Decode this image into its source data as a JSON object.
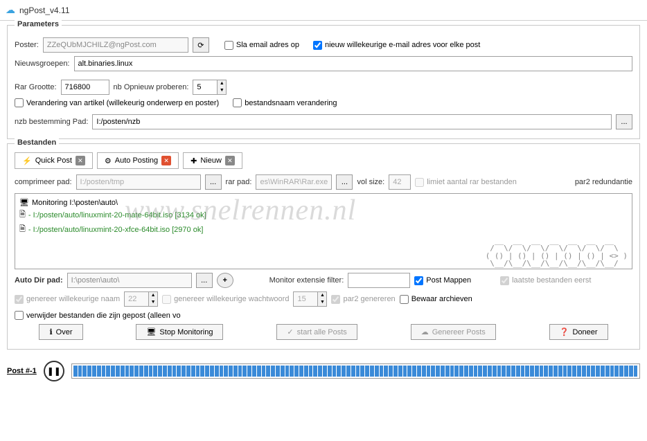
{
  "app": {
    "title": "ngPost_v4.11"
  },
  "params": {
    "legend": "Parameters",
    "poster_label": "Poster:",
    "poster_value": "ZZeQUbMJCHILZ@ngPost.com",
    "save_email_label": "Sla email adres op",
    "random_email_label": "nieuw willekeurige e-mail adres voor elke post",
    "newsgroups_label": "Nieuwsgroepen:",
    "newsgroups_value": "alt.binaries.linux",
    "rar_size_label": "Rar Grootte:",
    "rar_size_value": "716800",
    "retry_label": "nb Opnieuw proberen:",
    "retry_value": "5",
    "obfuscate_label": "Verandering van artikel (willekeurig onderwerp en poster)",
    "filename_obf_label": "bestandsnaam verandering",
    "nzb_path_label": "nzb bestemming Pad:",
    "nzb_path_value": "I:/posten/nzb"
  },
  "files": {
    "legend": "Bestanden",
    "tabs": {
      "quick": "Quick Post",
      "auto": "Auto Posting",
      "new": "Nieuw"
    },
    "compress_label": "comprimeer pad:",
    "compress_value": "I:/posten/tmp",
    "rar_path_label": "rar pad:",
    "rar_path_value": "es\\WinRAR\\Rar.exe",
    "vol_size_label": "vol size:",
    "vol_size_value": "42",
    "limit_rar_label": "limiet aantal rar bestanden",
    "par2_label": "par2 redundantie",
    "log": {
      "line1": "Monitoring I:\\posten\\auto\\",
      "line2": "- I:/posten/auto/linuxmint-20-mate-64bit.iso [3134 ok]",
      "line3": "- I:/posten/auto/linuxmint-20-xfce-64bit.iso [2970 ok]"
    },
    "autodir_label": "Auto Dir pad:",
    "autodir_value": "I:\\posten\\auto\\",
    "monitor_ext_label": "Monitor extensie filter:",
    "post_folders_label": "Post Mappen",
    "latest_first_label": "laatste bestanden eerst",
    "gen_name_label": "genereer willekeurige naam",
    "gen_name_len": "22",
    "gen_pass_label": "genereer willekeurige wachtwoord",
    "gen_pass_len": "15",
    "gen_par2_label": "par2 genereren",
    "keep_arch_label": "Bewaar archieven",
    "del_posted_label": "verwijder bestanden die zijn gepost (alleen vo",
    "btn_about": "Over",
    "btn_stopmon": "Stop Monitoring",
    "btn_startall": "start alle Posts",
    "btn_genposts": "Genereer Posts",
    "btn_donate": "Doneer"
  },
  "footer": {
    "post_label": "Post #-1"
  },
  "watermark": "www.snelrennen.nl"
}
